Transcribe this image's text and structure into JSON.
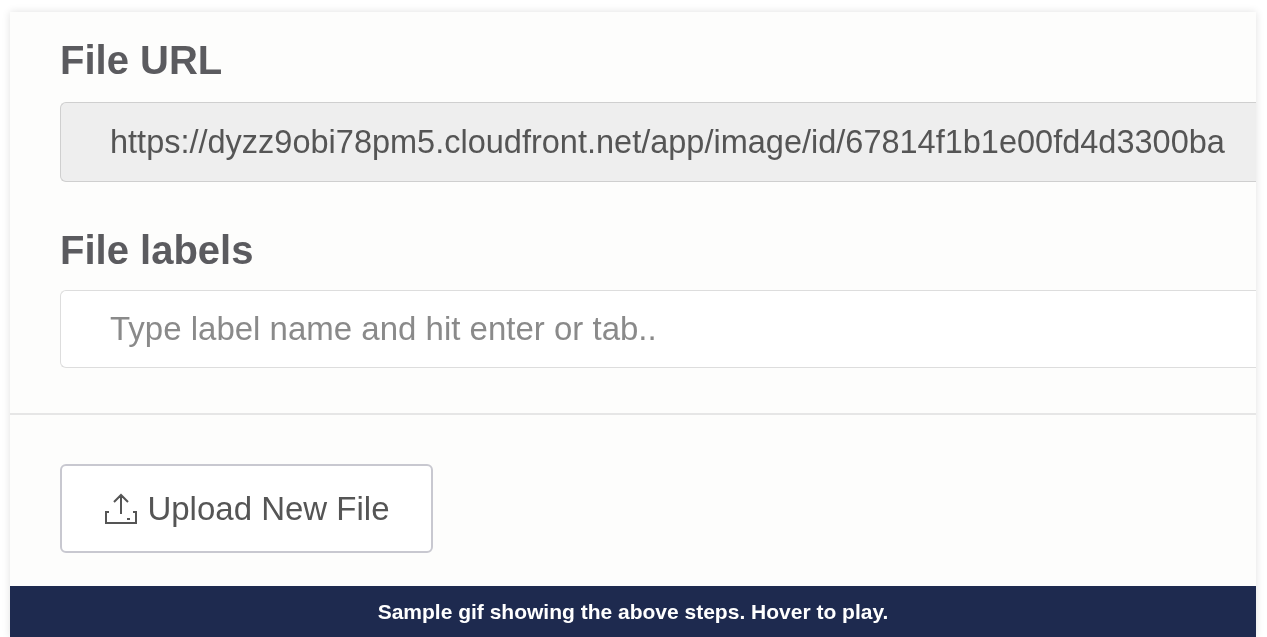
{
  "sections": [
    {
      "heading": "File URL",
      "field": {
        "kind": "readonly",
        "value": "https://dyzz9obi78pm5.cloudfront.net/app/image/id/67814f1b1e00fd4d3300ba"
      }
    },
    {
      "heading": "File labels",
      "field": {
        "kind": "input",
        "placeholder": "Type label name and hit enter or tab.."
      }
    }
  ],
  "upload_button": {
    "label": "Upload New File"
  },
  "caption": "Sample gif showing the above steps. Hover to play."
}
